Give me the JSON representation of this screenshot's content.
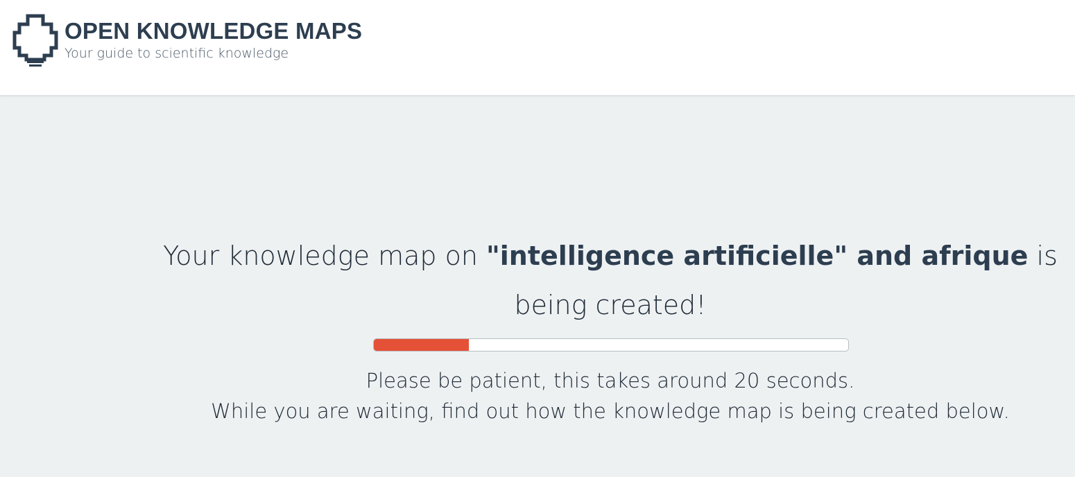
{
  "header": {
    "logo_icon": "lightbulb-puzzle-icon",
    "title": "OPEN KNOWLEDGE MAPS",
    "subtitle": "Your guide to scientific knowledge"
  },
  "status": {
    "headline_prefix": "Your knowledge map on ",
    "query": "\"intelligence artificielle\" and afrique",
    "headline_suffix": " is being created!",
    "progress_fraction": 0.2,
    "line1": "Please be patient, this takes around 20 seconds.",
    "line2": "While you are waiting, find out how the knowledge map is being created below."
  },
  "colors": {
    "brand_dark": "#2d3e50",
    "progress": "#e55137",
    "background": "#eef1f2",
    "header_bg": "#ffffff"
  }
}
